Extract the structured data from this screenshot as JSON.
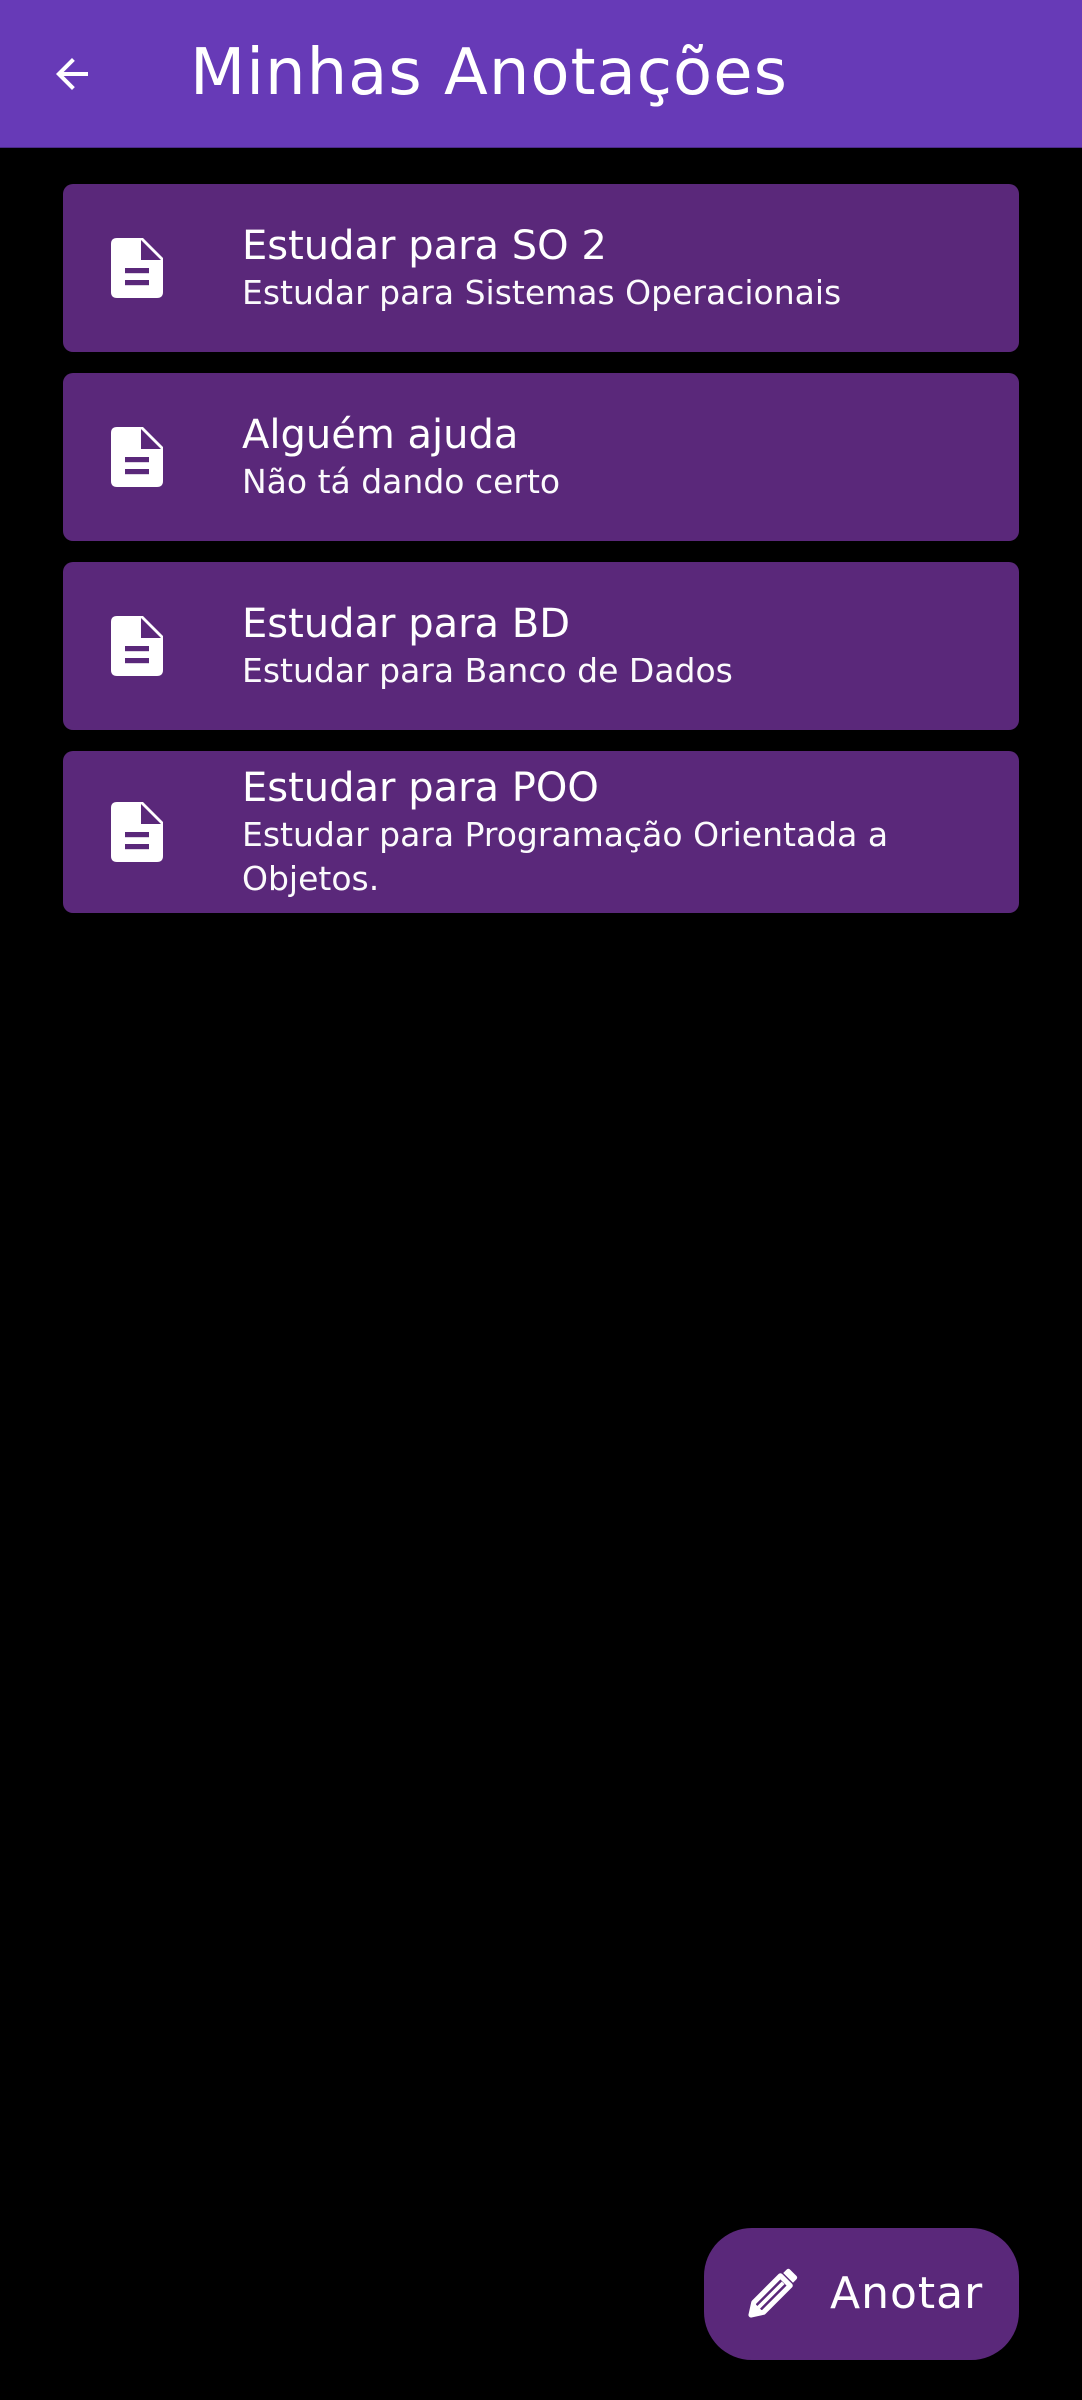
{
  "appbar": {
    "title": "Minhas Anotações",
    "back_icon": "arrow-left-icon",
    "color": "#673ab7"
  },
  "notes": [
    {
      "title": "Estudar para SO 2",
      "description": "Estudar para Sistemas Operacionais",
      "icon": "document-icon"
    },
    {
      "title": "Alguém ajuda",
      "description": "Não tá dando certo",
      "icon": "document-icon"
    },
    {
      "title": "Estudar para BD",
      "description": "Estudar para Banco de Dados",
      "icon": "document-icon"
    },
    {
      "title": "Estudar para POO",
      "description": "Estudar para Programação Orientada a Objetos.",
      "icon": "document-icon"
    }
  ],
  "fab": {
    "label": "Anotar",
    "icon": "pencil-icon",
    "color": "#5a287a"
  },
  "colors": {
    "background": "#000000",
    "card": "#5a287a",
    "text": "#ffffff"
  }
}
